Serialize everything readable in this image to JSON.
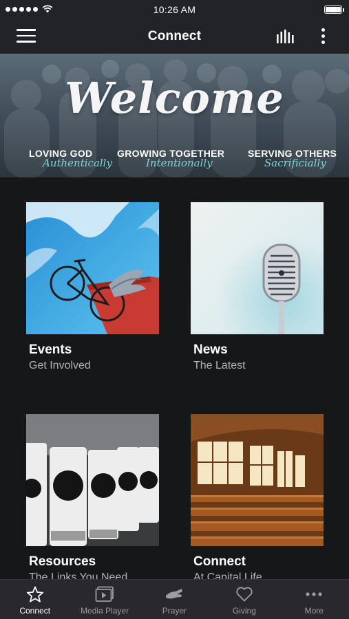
{
  "status_bar": {
    "time": "10:26 AM"
  },
  "nav": {
    "title": "Connect"
  },
  "banner": {
    "headline": "Welcome",
    "taglines": [
      {
        "label": "LOVING GOD",
        "script": "Authentically"
      },
      {
        "label": "GROWING TOGETHER",
        "script": "Intentionally"
      },
      {
        "label": "SERVING OTHERS",
        "script": "Sacrificially"
      }
    ]
  },
  "cards": [
    {
      "title": "Events",
      "subtitle": "Get Involved",
      "icon": "bicycle-wings-image"
    },
    {
      "title": "News",
      "subtitle": "The Latest",
      "icon": "microphone-image"
    },
    {
      "title": "Resources",
      "subtitle": "The Links You Need",
      "icon": "tumblers-image"
    },
    {
      "title": "Connect",
      "subtitle": "At Capital Life",
      "icon": "sanctuary-image"
    }
  ],
  "tabs": [
    {
      "label": "Connect",
      "icon": "star-icon",
      "active": true
    },
    {
      "label": "Media Player",
      "icon": "media-player-icon",
      "active": false
    },
    {
      "label": "Prayer",
      "icon": "prayer-hands-icon",
      "active": false
    },
    {
      "label": "Giving",
      "icon": "heart-icon",
      "active": false
    },
    {
      "label": "More",
      "icon": "more-dots-icon",
      "active": false
    }
  ],
  "colors": {
    "background": "#161719",
    "bar": "#222327",
    "accent_script": "#7fd3d6",
    "subtitle": "#b3b4b7"
  }
}
